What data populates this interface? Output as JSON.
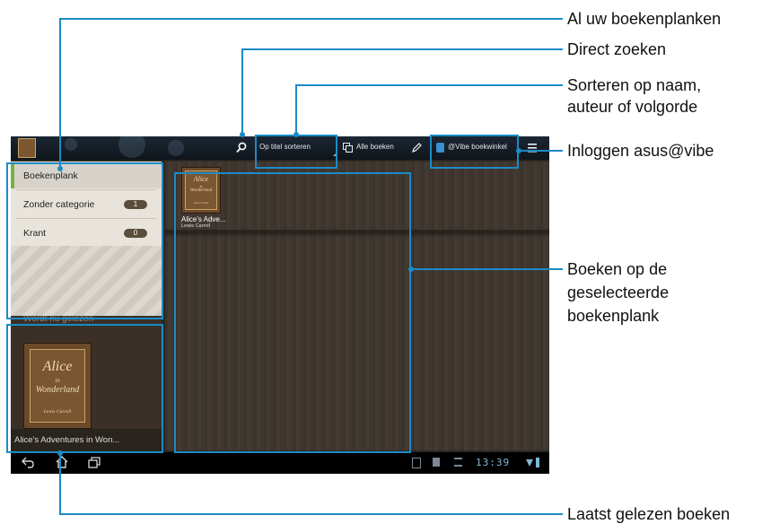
{
  "callouts": {
    "bookshelves": "Al uw boekenplanken",
    "search": "Direct zoeken",
    "sort_line1": "Sorteren op naam,",
    "sort_line2": "auteur of volgorde",
    "login": "Inloggen asus@vibe",
    "books_line1": "Boeken op de",
    "books_line2": "geselecteerde",
    "books_line3": "boekenplank",
    "recent": "Laatst gelezen boeken"
  },
  "topbar": {
    "sort_label": "Op titel sorteren",
    "all_books_label": "Alle boeken",
    "vibe_label": "@Vibe boekwinkel",
    "icons": [
      "app-icon",
      "search-icon",
      "all-books-icon",
      "edit-icon",
      "vibe-icon",
      "menu-icon"
    ]
  },
  "sidebar": {
    "items": [
      {
        "label": "Boekenplank"
      },
      {
        "label": "Zonder categorie",
        "count": "1"
      },
      {
        "label": "Krant",
        "count": "0"
      }
    ]
  },
  "recent": {
    "title": "Wordt nu gelezen",
    "book_caption": "Alice's Adventures in Won...",
    "cover_title1": "Alice",
    "cover_title2": "in",
    "cover_title3": "Wonderland",
    "cover_author": "Lewis Carroll"
  },
  "shelf": {
    "books": [
      {
        "title": "Alice's Adve...",
        "author": "Lewis Carroll",
        "cover_title1": "Alice",
        "cover_title2": "in",
        "cover_title3": "Wonderland",
        "cover_author": "Lewis Carroll"
      }
    ]
  },
  "statusbar": {
    "time": "13:39"
  },
  "colors": {
    "callout_blue": "#1b8bc6",
    "shelf_wood": "#3e362f",
    "sidebar_bg": "#e8e4dc",
    "selected_marker": "#7cae4a"
  }
}
